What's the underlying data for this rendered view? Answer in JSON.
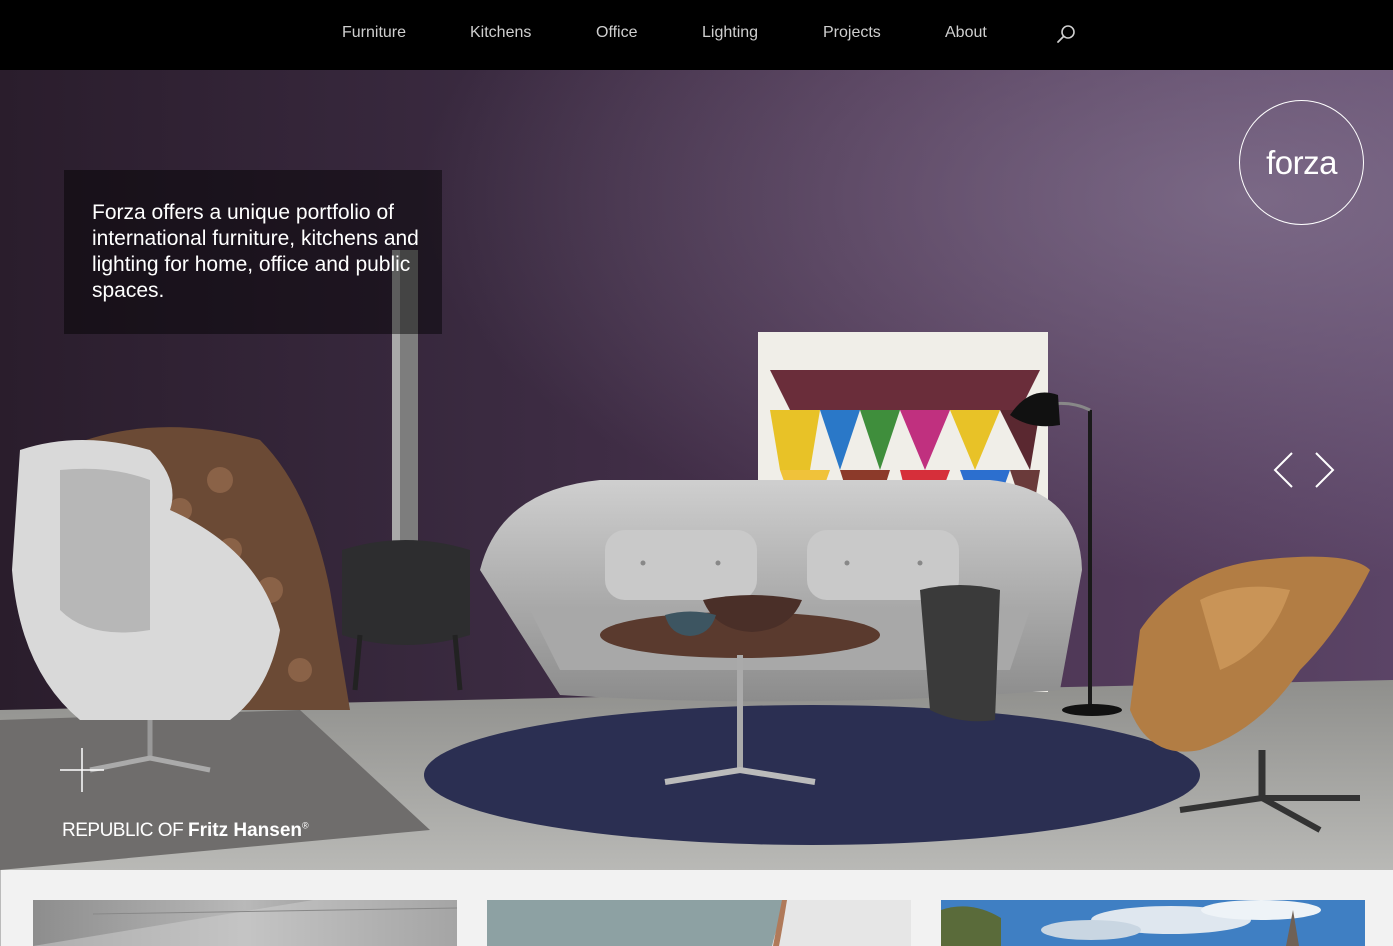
{
  "nav": {
    "items": [
      {
        "label": "Furniture"
      },
      {
        "label": "Kitchens"
      },
      {
        "label": "Office"
      },
      {
        "label": "Lighting"
      },
      {
        "label": "Projects"
      },
      {
        "label": "About"
      }
    ],
    "search_icon": "search-icon"
  },
  "hero": {
    "intro_text": "Forza offers a unique portfolio of international furniture, kitchens and lighting for home, office and public spaces.",
    "logo_text": "forza",
    "brand": {
      "prefix": "REPUBLIC OF ",
      "name": "Fritz Hansen",
      "mark": "®"
    },
    "icons": {
      "prev": "chevron-left-icon",
      "next": "chevron-right-icon",
      "expand": "plus-icon"
    }
  },
  "tiles": [
    {
      "name": "architecture-tile"
    },
    {
      "name": "fabric-tile"
    },
    {
      "name": "sky-tile"
    }
  ],
  "colors": {
    "nav_bg": "#000000",
    "nav_text": "#cfcfcf",
    "wall": "#3a2a40",
    "rug": "#2b2f52"
  }
}
